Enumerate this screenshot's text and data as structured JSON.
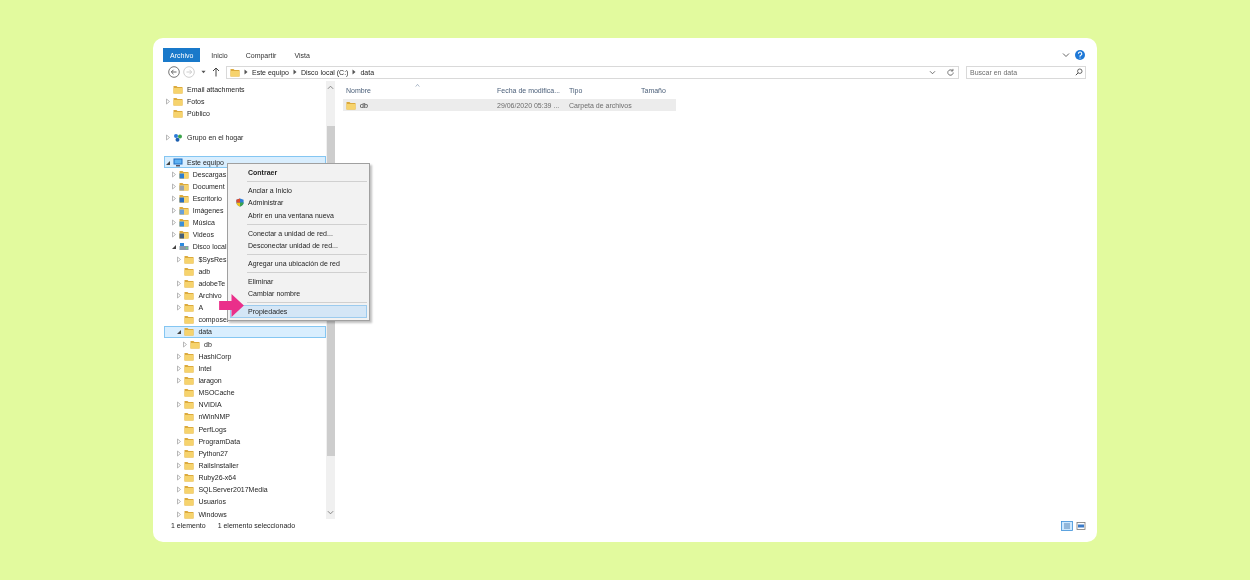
{
  "ribbon": {
    "tabs": [
      {
        "label": "Archivo",
        "selected": true
      },
      {
        "label": "Inicio",
        "selected": false
      },
      {
        "label": "Compartir",
        "selected": false
      },
      {
        "label": "Vista",
        "selected": false
      }
    ]
  },
  "address_bar": {
    "breadcrumbs": [
      "Este equipo",
      "Disco local (C:)",
      "data"
    ],
    "search": {
      "placeholder": "Buscar en data"
    }
  },
  "sidebar": {
    "sections": [
      [
        {
          "label": "Email attachments",
          "kind": "folder",
          "expandable": false,
          "selected": false
        },
        {
          "label": "Fotos",
          "kind": "folder",
          "expandable": true,
          "expanded": false,
          "selected": false
        },
        {
          "label": "Público",
          "kind": "folder",
          "expandable": false,
          "selected": false
        }
      ],
      [
        {
          "label": "Grupo en el hogar",
          "kind": "homegroup",
          "expandable": true,
          "expanded": false,
          "selected": false
        }
      ],
      [
        {
          "label": "Este equipo",
          "kind": "computer",
          "expandable": true,
          "expanded": true,
          "selected": true,
          "children": [
            {
              "label": "Descargas",
              "kind": "downloads",
              "expandable": true,
              "expanded": false,
              "selected": false
            },
            {
              "label": "Document",
              "kind": "documents",
              "expandable": true,
              "expanded": false,
              "selected": false
            },
            {
              "label": "Escritorio",
              "kind": "desktop",
              "expandable": true,
              "expanded": false,
              "selected": false
            },
            {
              "label": "Imágenes",
              "kind": "pictures",
              "expandable": true,
              "expanded": false,
              "selected": false
            },
            {
              "label": "Música",
              "kind": "music",
              "expandable": true,
              "expanded": false,
              "selected": false
            },
            {
              "label": "Videos",
              "kind": "videos",
              "expandable": true,
              "expanded": false,
              "selected": false
            },
            {
              "label": "Disco local",
              "kind": "drive",
              "expandable": true,
              "expanded": true,
              "selected": false,
              "children": [
                {
                  "label": "$SysRes",
                  "kind": "folder",
                  "expandable": true,
                  "expanded": false,
                  "selected": false
                },
                {
                  "label": "adb",
                  "kind": "folder",
                  "expandable": false,
                  "selected": false
                },
                {
                  "label": "adobeTe",
                  "kind": "folder",
                  "expandable": true,
                  "expanded": false,
                  "selected": false
                },
                {
                  "label": "Archivo",
                  "kind": "folder",
                  "expandable": true,
                  "expanded": false,
                  "selected": false
                },
                {
                  "label": "A",
                  "kind": "folder",
                  "expandable": true,
                  "expanded": false,
                  "selected": false
                },
                {
                  "label": "composer",
                  "kind": "folder",
                  "expandable": false,
                  "selected": false
                },
                {
                  "label": "data",
                  "kind": "folder",
                  "expandable": true,
                  "expanded": true,
                  "selected": true,
                  "children": [
                    {
                      "label": "db",
                      "kind": "folder",
                      "expandable": true,
                      "expanded": false,
                      "selected": false
                    }
                  ]
                },
                {
                  "label": "HashiCorp",
                  "kind": "folder",
                  "expandable": true,
                  "expanded": false,
                  "selected": false
                },
                {
                  "label": "Intel",
                  "kind": "folder",
                  "expandable": true,
                  "expanded": false,
                  "selected": false
                },
                {
                  "label": "laragon",
                  "kind": "folder",
                  "expandable": true,
                  "expanded": false,
                  "selected": false
                },
                {
                  "label": "MSOCache",
                  "kind": "folder",
                  "expandable": false,
                  "selected": false
                },
                {
                  "label": "NVIDIA",
                  "kind": "folder",
                  "expandable": true,
                  "expanded": false,
                  "selected": false
                },
                {
                  "label": "nWinNMP",
                  "kind": "folder",
                  "expandable": false,
                  "selected": false
                },
                {
                  "label": "PerfLogs",
                  "kind": "folder",
                  "expandable": false,
                  "selected": false
                },
                {
                  "label": "ProgramData",
                  "kind": "folder",
                  "expandable": true,
                  "expanded": false,
                  "selected": false
                },
                {
                  "label": "Python27",
                  "kind": "folder",
                  "expandable": true,
                  "expanded": false,
                  "selected": false
                },
                {
                  "label": "RailsInstaller",
                  "kind": "folder",
                  "expandable": true,
                  "expanded": false,
                  "selected": false
                },
                {
                  "label": "Ruby26-x64",
                  "kind": "folder",
                  "expandable": true,
                  "expanded": false,
                  "selected": false
                },
                {
                  "label": "SQLServer2017Media",
                  "kind": "folder",
                  "expandable": true,
                  "expanded": false,
                  "selected": false
                },
                {
                  "label": "Usuarios",
                  "kind": "folder",
                  "expandable": true,
                  "expanded": false,
                  "selected": false
                },
                {
                  "label": "Windows",
                  "kind": "folder",
                  "expandable": true,
                  "expanded": false,
                  "selected": false
                }
              ]
            }
          ]
        }
      ]
    ]
  },
  "context_menu": {
    "groups": [
      [
        {
          "label": "Contraer",
          "kind": "default",
          "selected": false
        }
      ],
      [
        {
          "label": "Anclar a Inicio",
          "kind": "plain",
          "selected": false
        },
        {
          "label": "Administrar",
          "kind": "shield",
          "selected": false
        },
        {
          "label": "Abrir en una ventana nueva",
          "kind": "plain",
          "selected": false
        }
      ],
      [
        {
          "label": "Conectar a unidad de red...",
          "kind": "plain",
          "selected": false
        },
        {
          "label": "Desconectar unidad de red...",
          "kind": "plain",
          "selected": false
        }
      ],
      [
        {
          "label": "Agregar una ubicación de red",
          "kind": "plain",
          "selected": false
        }
      ],
      [
        {
          "label": "Eliminar",
          "kind": "plain",
          "selected": false
        },
        {
          "label": "Cambiar nombre",
          "kind": "plain",
          "selected": false
        }
      ],
      [
        {
          "label": "Propiedades",
          "kind": "plain",
          "selected": true
        }
      ]
    ]
  },
  "file_list": {
    "columns": [
      "Nombre",
      "Fecha de modifica...",
      "Tipo",
      "Tamaño"
    ],
    "rows": [
      {
        "cells": [
          "db",
          "29/06/2020 05:39 ...",
          "Carpeta de archivos"
        ],
        "selected": true
      }
    ]
  },
  "status_bar": {
    "item_count": "1 elemento",
    "selection": "1 elemento seleccionado"
  }
}
